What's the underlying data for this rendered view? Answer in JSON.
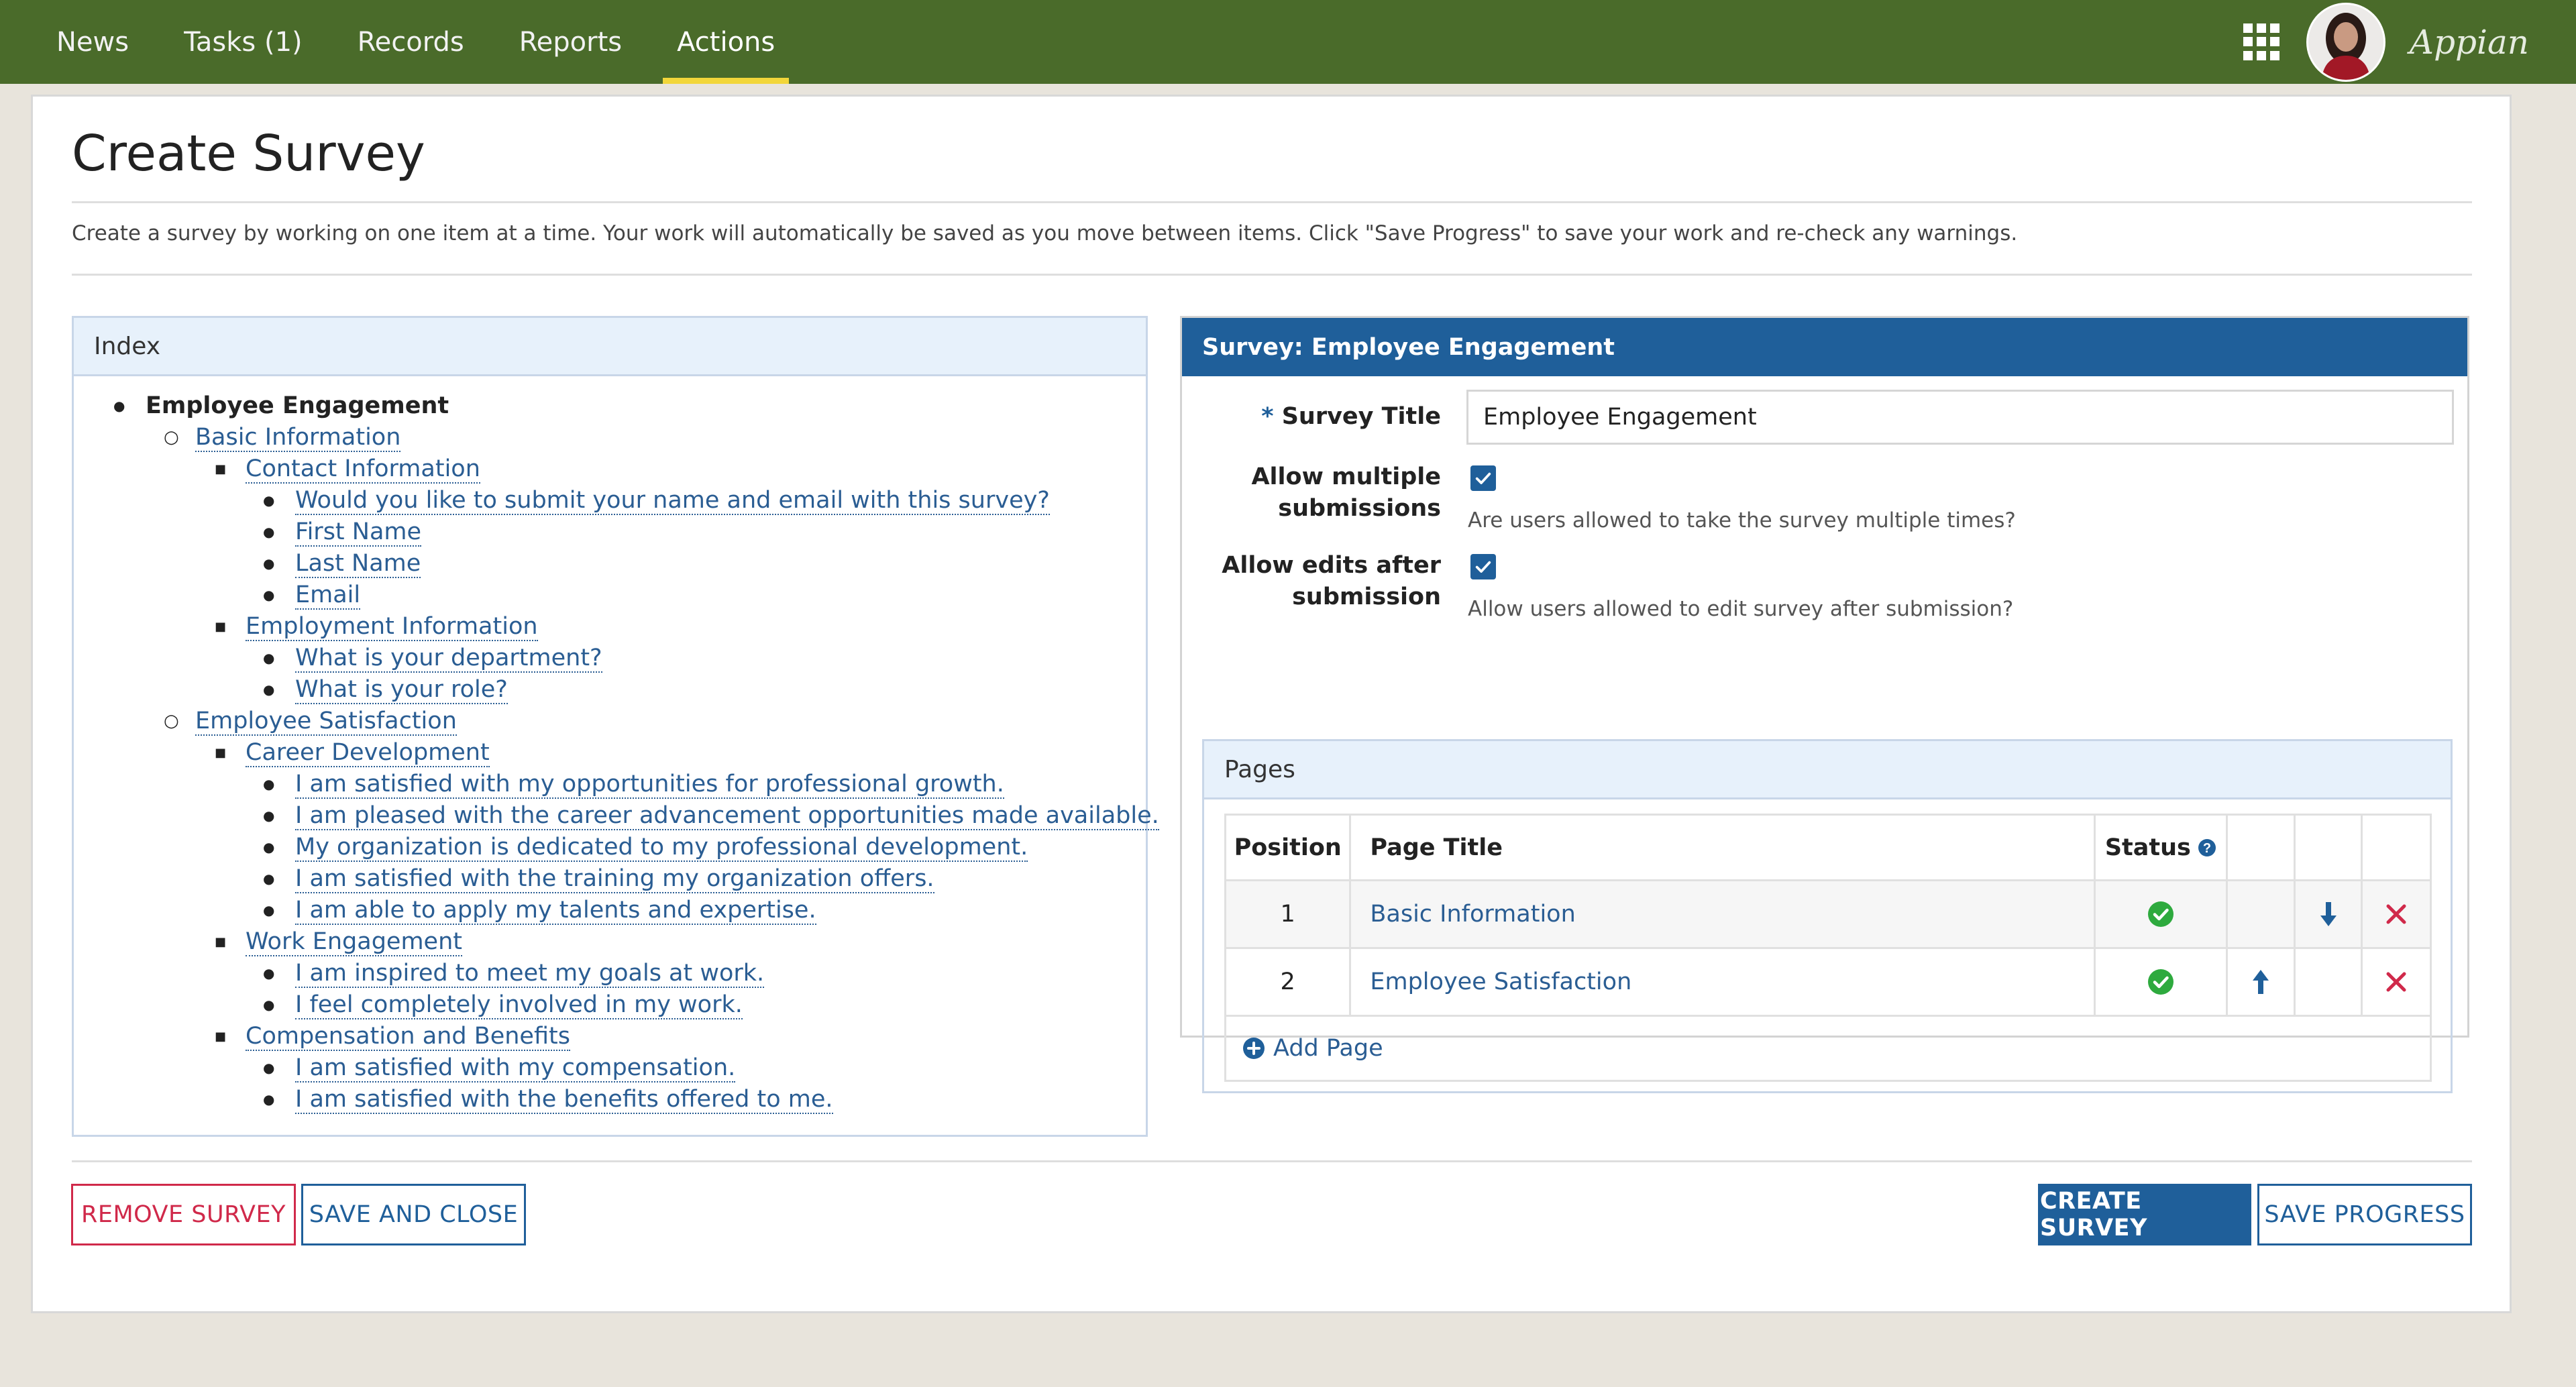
{
  "nav": {
    "tabs": [
      {
        "label": "News"
      },
      {
        "label": "Tasks (1)"
      },
      {
        "label": "Records"
      },
      {
        "label": "Reports"
      },
      {
        "label": "Actions",
        "active": true
      }
    ],
    "brand": "Appian",
    "icons": {
      "apps": "apps-grid-icon",
      "avatar": "user-avatar"
    }
  },
  "page": {
    "title": "Create Survey",
    "intro": "Create a survey by working on one item at a time. Your work will automatically be saved as you move between items. Click \"Save Progress\" to save your work and re-check any warnings."
  },
  "index": {
    "header": "Index",
    "root": "Employee Engagement",
    "sections": [
      {
        "label": "Basic Information",
        "groups": [
          {
            "label": "Contact Information",
            "items": [
              "Would you like to submit your name and email with this survey?",
              "First Name",
              "Last Name",
              "Email"
            ]
          },
          {
            "label": "Employment Information",
            "items": [
              "What is your department?",
              "What is your role?"
            ]
          }
        ]
      },
      {
        "label": "Employee Satisfaction",
        "groups": [
          {
            "label": "Career Development",
            "items": [
              "I am satisfied with my opportunities for professional growth.",
              "I am pleased with the career advancement opportunities made available.",
              "My organization is dedicated to my professional development.",
              "I am satisfied with the training my organization offers.",
              "I am able to apply my talents and expertise."
            ]
          },
          {
            "label": "Work Engagement",
            "items": [
              "I am inspired to meet my goals at work.",
              "I feel completely involved in my work."
            ]
          },
          {
            "label": "Compensation and Benefits",
            "items": [
              "I am satisfied with my compensation.",
              "I am satisfied with the benefits offered to me."
            ]
          }
        ]
      }
    ]
  },
  "survey": {
    "header": "Survey: Employee Engagement",
    "title_label": "Survey Title",
    "required_marker": "*",
    "title_value": "Employee Engagement",
    "multiple_label_1": "Allow multiple",
    "multiple_label_2": "submissions",
    "multiple_checked": true,
    "multiple_help": "Are users allowed to take the survey multiple times?",
    "edits_label_1": "Allow edits after",
    "edits_label_2": "submission",
    "edits_checked": true,
    "edits_help": "Allow users allowed to edit survey after submission?",
    "pages": {
      "header": "Pages",
      "columns": {
        "position": "Position",
        "title": "Page Title",
        "status": "Status"
      },
      "rows": [
        {
          "position": "1",
          "title": "Basic Information",
          "status": "complete",
          "can_move_up": false,
          "can_move_down": true
        },
        {
          "position": "2",
          "title": "Employee Satisfaction",
          "status": "complete",
          "can_move_up": true,
          "can_move_down": false
        }
      ],
      "add_label": "Add Page"
    }
  },
  "buttons": {
    "remove": "REMOVE SURVEY",
    "save_close": "SAVE AND CLOSE",
    "create": "CREATE SURVEY",
    "save_progress": "SAVE PROGRESS"
  },
  "colors": {
    "nav_bg": "#4a6b2a",
    "active_tab_underline": "#f2d63a",
    "primary": "#1f5f9a",
    "link": "#2a5d93",
    "danger": "#d0294a",
    "success": "#2eaa3e"
  }
}
